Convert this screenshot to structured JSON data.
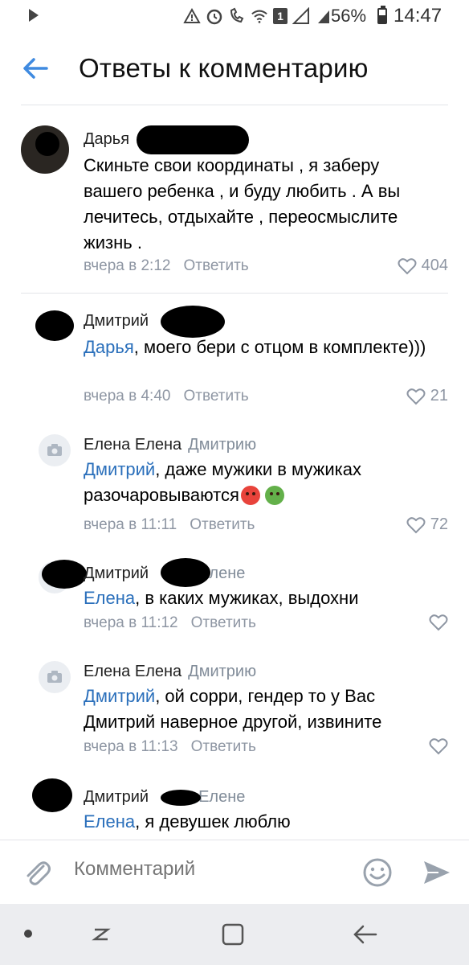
{
  "status_bar": {
    "battery": "56%",
    "time": "14:47",
    "sim_badge": "1",
    "icons": [
      "play-icon",
      "alarm-icon",
      "vowifi-icon",
      "wifi-icon",
      "sim-icon",
      "signal-icon",
      "signal2-icon",
      "battery-icon"
    ]
  },
  "header": {
    "title": "Ответы к комментарию",
    "back_icon": "arrow-left-icon"
  },
  "comments": [
    {
      "author": "Дарья",
      "reply_to": "",
      "text": "Скиньте свои координаты , я заберу вашего ребенка , и буду любить . А вы лечитесь, отдыхайте , переосмыслите жизнь .",
      "mention": "",
      "time": "вчера в 2:12",
      "reply_label": "Ответить",
      "likes": "404"
    },
    {
      "author": "Дмитрий",
      "reply_to": "",
      "mention": "Дарья",
      "text": ", моего бери с отцом в комплекте)))",
      "time": "вчера в 4:40",
      "reply_label": "Ответить",
      "likes": "21"
    },
    {
      "author": "Елена Елена",
      "reply_to": "Дмитрию",
      "mention": "Дмитрий",
      "text": ", даже мужики в мужиках разочаровываются",
      "time": "вчера в 11:11",
      "reply_label": "Ответить",
      "likes": "72"
    },
    {
      "author": "Дмитрий",
      "reply_to": "Елене",
      "mention": "Елена",
      "text": ", в каких мужиках, выдохни",
      "time": "вчера в 11:12",
      "reply_label": "Ответить",
      "likes": ""
    },
    {
      "author": "Елена Елена",
      "reply_to": "Дмитрию",
      "mention": "Дмитрий",
      "text": ", ой сорри, гендер то у Вас Дмитрий наверное другой, извините",
      "time": "вчера в 11:13",
      "reply_label": "Ответить",
      "likes": ""
    },
    {
      "author": "Дмитрий",
      "reply_to": "Елене",
      "mention": "Елена",
      "text": ", я девушек люблю",
      "time": "",
      "reply_label": "",
      "likes": ""
    }
  ],
  "composer": {
    "placeholder": "Комментарий",
    "attach_icon": "paperclip-icon",
    "emoji_icon": "smiley-icon",
    "send_icon": "send-icon"
  },
  "colors": {
    "accent": "#2a6fbb",
    "back_arrow": "#3f8ae0",
    "secondary_text": "#818c99",
    "divider": "#e3e4e8"
  }
}
